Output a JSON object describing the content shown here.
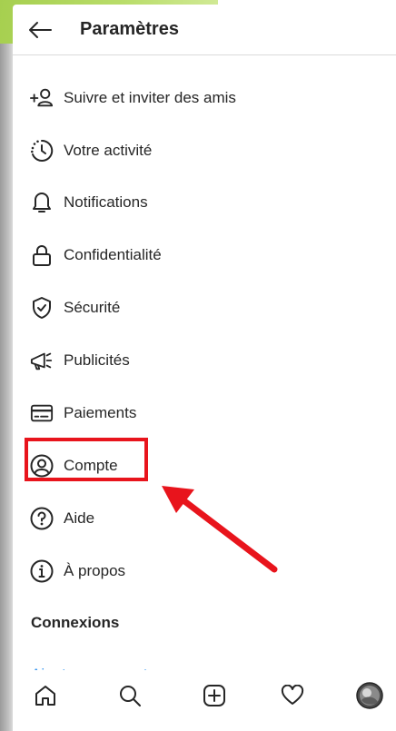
{
  "header": {
    "title": "Paramètres",
    "back_icon": "arrow-left-icon"
  },
  "menu": {
    "items": [
      {
        "label": "Suivre et inviter des amis",
        "icon": "add-person-icon"
      },
      {
        "label": "Votre activité",
        "icon": "activity-clock-icon"
      },
      {
        "label": "Notifications",
        "icon": "bell-icon"
      },
      {
        "label": "Confidentialité",
        "icon": "lock-icon"
      },
      {
        "label": "Sécurité",
        "icon": "shield-check-icon"
      },
      {
        "label": "Publicités",
        "icon": "megaphone-icon"
      },
      {
        "label": "Paiements",
        "icon": "credit-card-icon"
      },
      {
        "label": "Compte",
        "icon": "user-circle-icon"
      },
      {
        "label": "Aide",
        "icon": "question-circle-icon"
      },
      {
        "label": "À propos",
        "icon": "info-circle-icon"
      }
    ]
  },
  "connections": {
    "title": "Connexions",
    "add_account": "Ajouter un compte"
  },
  "annotation": {
    "highlight_color": "#e8141c"
  },
  "bottom_nav": {
    "items": [
      "home-icon",
      "search-icon",
      "new-post-icon",
      "activity-heart-icon",
      "profile-avatar"
    ]
  },
  "colors": {
    "link": "#3897f0",
    "text": "#262626",
    "divider": "#dbdbdb"
  }
}
